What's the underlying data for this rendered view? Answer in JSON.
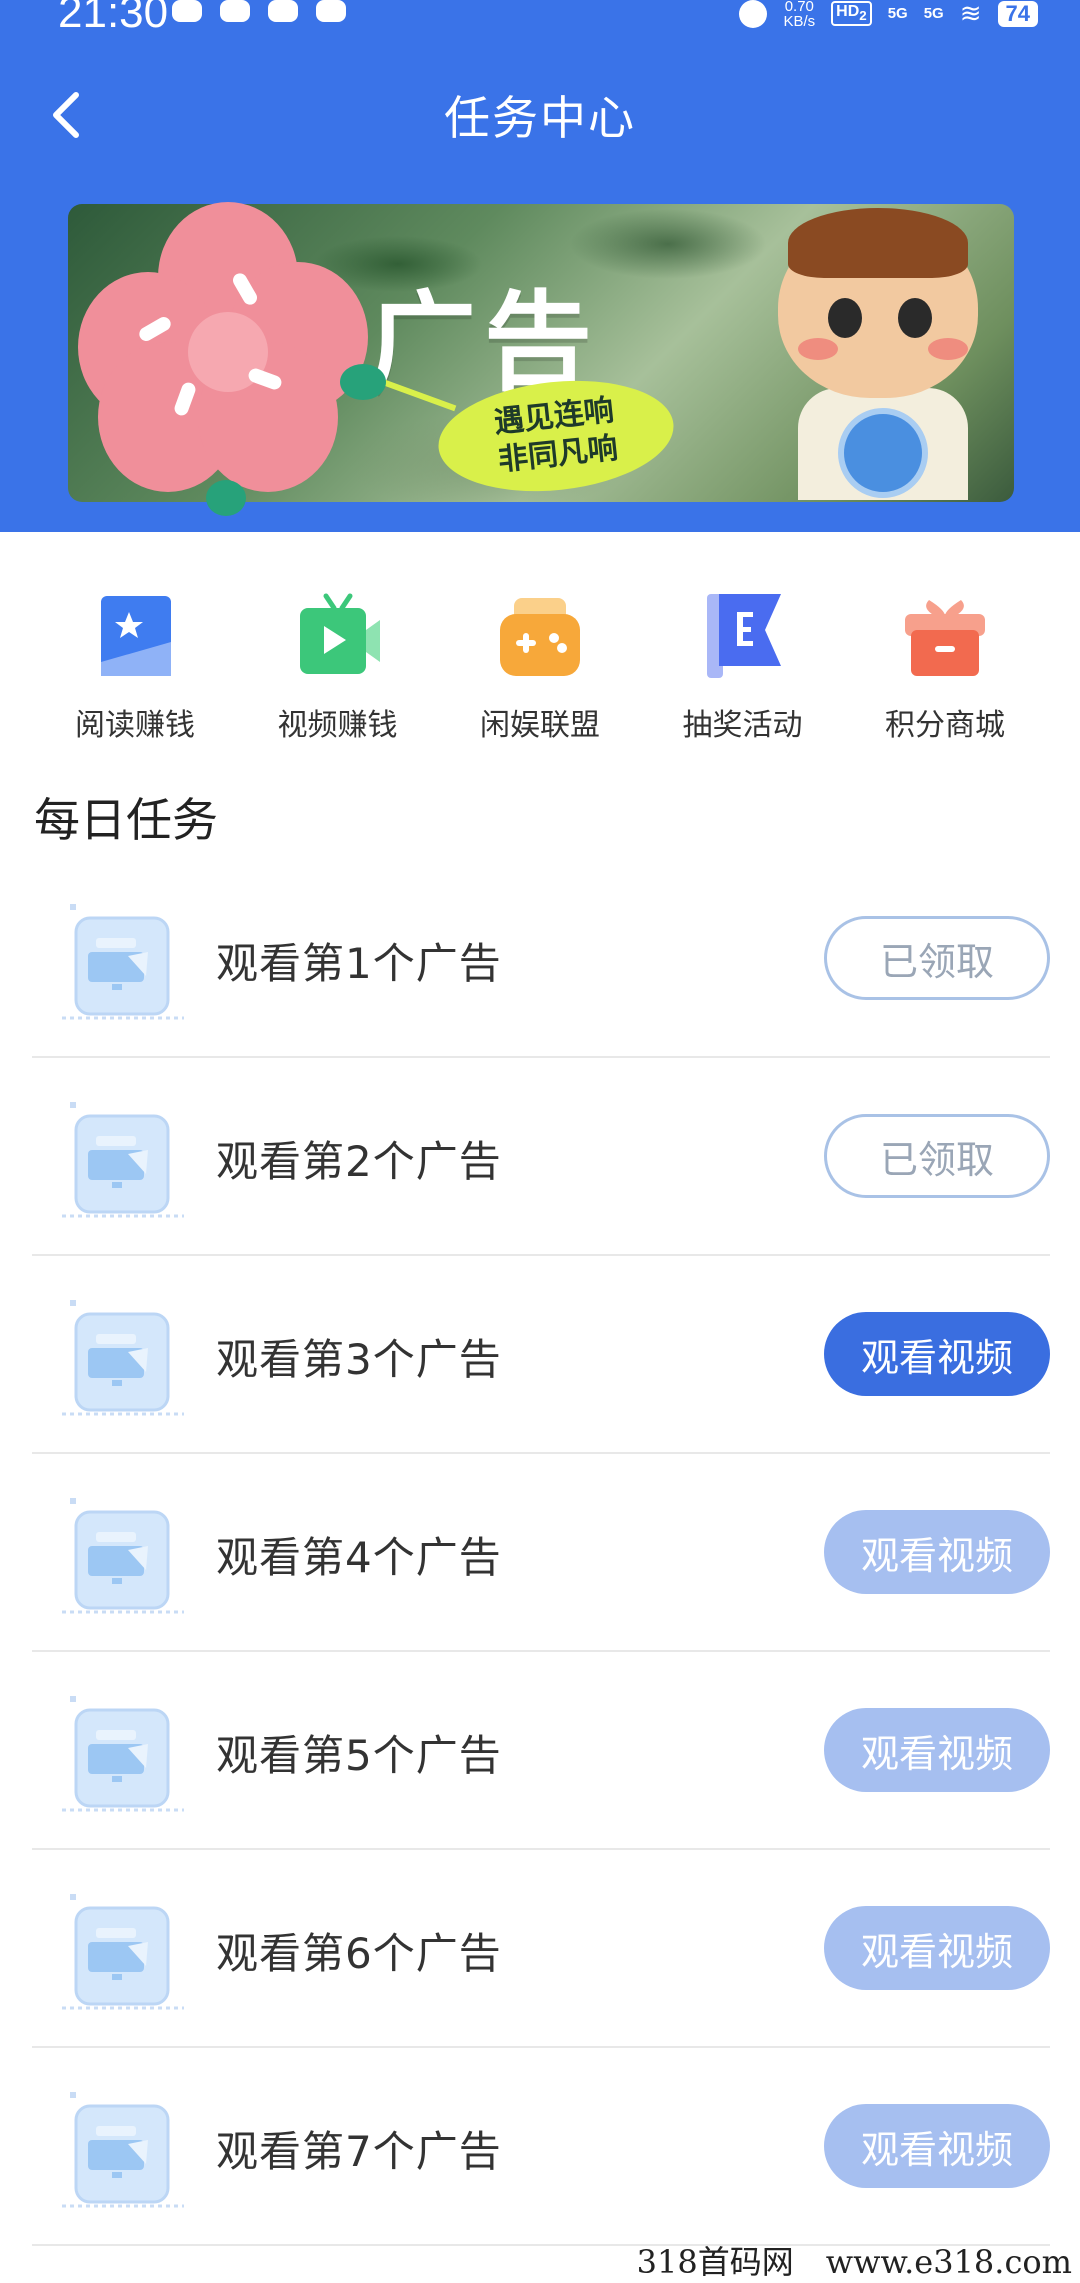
{
  "status_bar": {
    "time": "21:30",
    "net_speed_value": "0.70",
    "net_speed_unit": "KB/s",
    "hd_label": "HD",
    "hd_sub": "2",
    "signal1": "5G",
    "signal2": "5G",
    "battery": "74"
  },
  "nav": {
    "title": "任务中心"
  },
  "banner": {
    "title": "广告",
    "subtitle_line1": "遇见连响",
    "subtitle_line2": "非同凡响"
  },
  "quick_menu": [
    {
      "label": "阅读赚钱",
      "icon": "book-star-icon",
      "color": "#3f7cf0"
    },
    {
      "label": "视频赚钱",
      "icon": "tv-play-icon",
      "color": "#3cc77a"
    },
    {
      "label": "闲娱联盟",
      "icon": "gamepad-icon",
      "color": "#f7a83a"
    },
    {
      "label": "抽奖活动",
      "icon": "flag-icon",
      "color": "#4a6cf0"
    },
    {
      "label": "积分商城",
      "icon": "gift-box-icon",
      "color": "#f26a4f"
    }
  ],
  "daily_tasks": {
    "title": "每日任务",
    "items": [
      {
        "name": "观看第1个广告",
        "button": "已领取",
        "state": "claimed"
      },
      {
        "name": "观看第2个广告",
        "button": "已领取",
        "state": "claimed"
      },
      {
        "name": "观看第3个广告",
        "button": "观看视频",
        "state": "active"
      },
      {
        "name": "观看第4个广告",
        "button": "观看视频",
        "state": "disabled"
      },
      {
        "name": "观看第5个广告",
        "button": "观看视频",
        "state": "disabled"
      },
      {
        "name": "观看第6个广告",
        "button": "观看视频",
        "state": "disabled"
      },
      {
        "name": "观看第7个广告",
        "button": "观看视频",
        "state": "disabled"
      }
    ]
  },
  "colors": {
    "header_blue": "#3a73e8",
    "button_active": "#3a6ee0",
    "button_disabled": "#a6bff0",
    "button_claimed_border": "#a9c2e6"
  },
  "watermark": "318首码网　www.e318.com"
}
